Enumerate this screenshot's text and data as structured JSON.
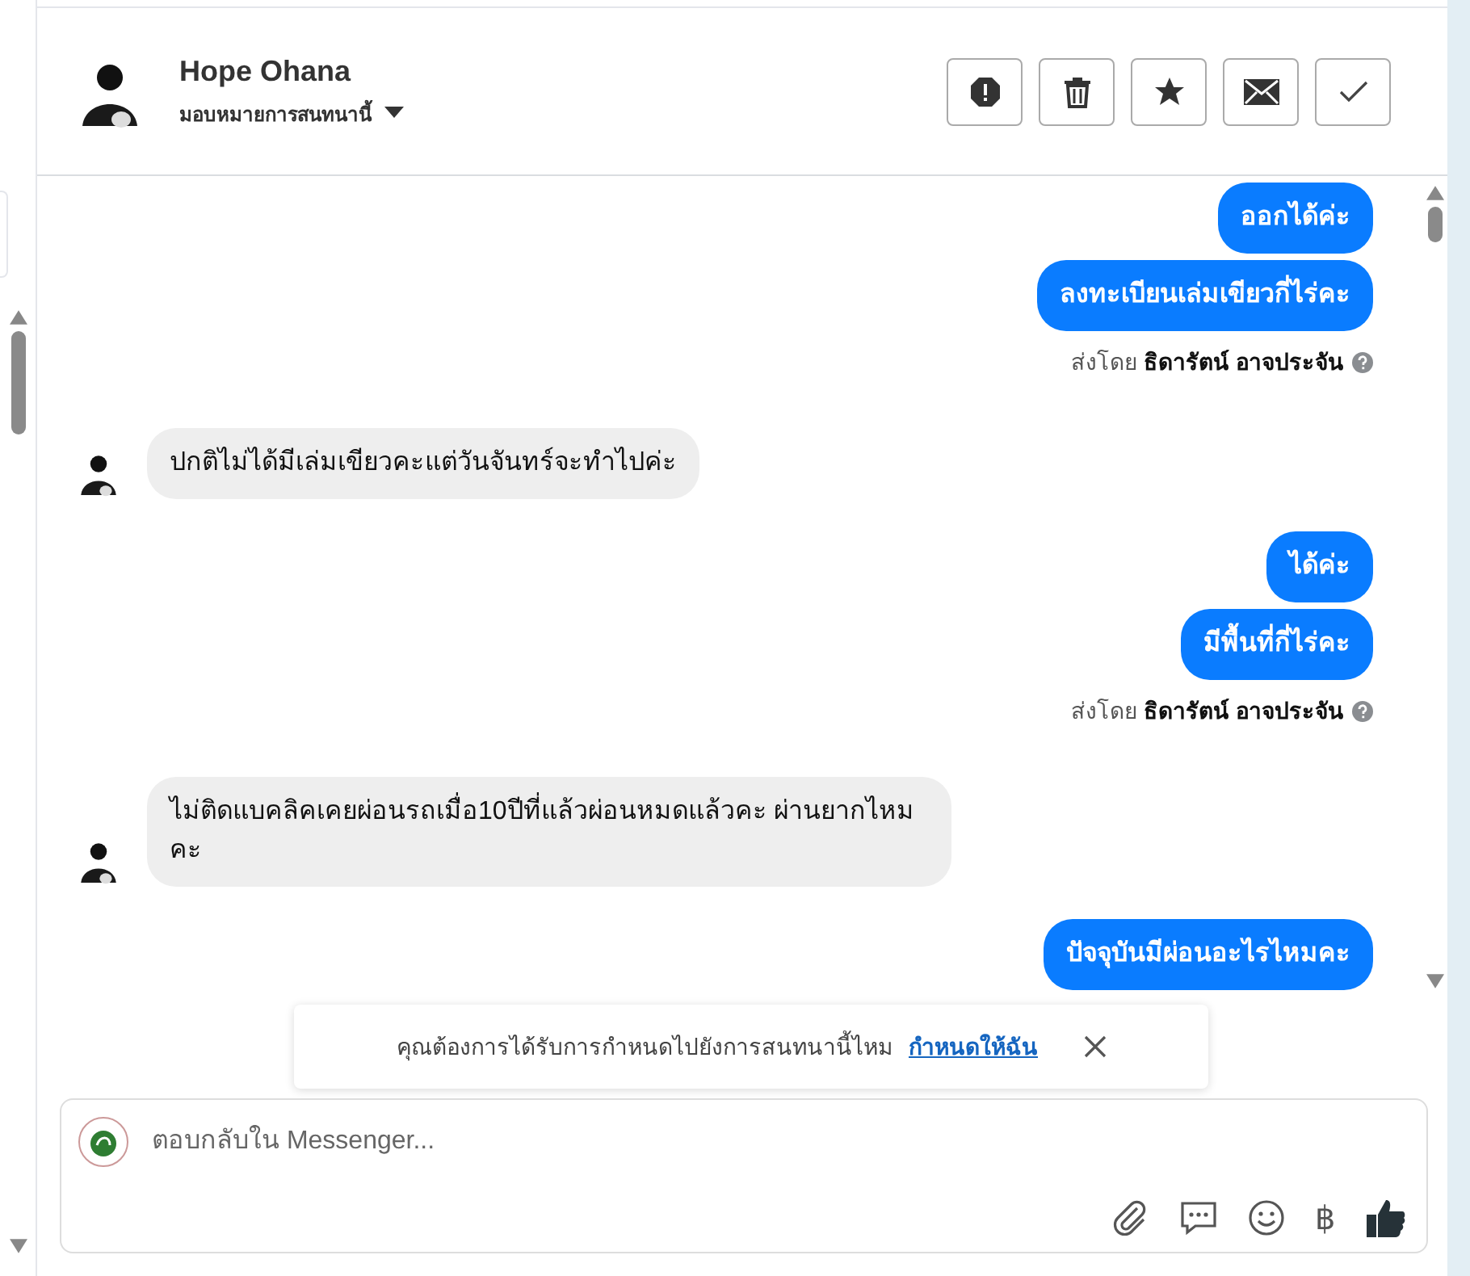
{
  "header": {
    "name": "Hope Ohana",
    "assign": "มอบหมายการสนทนานี้",
    "actions": [
      {
        "kind": "alert"
      },
      {
        "kind": "trash"
      },
      {
        "kind": "star"
      },
      {
        "kind": "mail"
      },
      {
        "kind": "check"
      }
    ]
  },
  "messages": [
    {
      "kind": "out",
      "text": "ออกได้ค่ะ"
    },
    {
      "kind": "out",
      "text": "ลงทะเบียนเล่มเขียวกี่ไร่คะ"
    },
    {
      "kind": "sent_by",
      "text": "ส่งโดย **ธิดารัตน์ อาจประจัน**"
    },
    {
      "kind": "in",
      "text": "ปกติไม่ได้มีเล่มเขียวคะแต่วันจันทร์จะทำไปค่ะ"
    },
    {
      "kind": "out",
      "text": "ได้ค่ะ"
    },
    {
      "kind": "out",
      "text": "มีพื้นที่กี่ไร่คะ"
    },
    {
      "kind": "sent_by",
      "text": "ส่งโดย **ธิดารัตน์ อาจประจัน**"
    },
    {
      "kind": "in",
      "text": "ไม่ติดแบคลิคเคยผ่อนรถเมื่อ10ปีที่แล้วผ่อนหมดแล้วคะ ผ่านยากไหมคะ"
    },
    {
      "kind": "out",
      "text": "ปัจจุบันมีผ่อนอะไรไหมคะ"
    }
  ],
  "toast": {
    "text": "คุณต้องการได้รับการกำหนดไปยังการสนทนานี้ไหม",
    "link": "กำหนดให้ฉัน"
  },
  "composer": {
    "placeholder": "ตอบกลับใน Messenger...",
    "tools": [
      {
        "kind": "clip"
      },
      {
        "kind": "chat"
      },
      {
        "kind": "smile"
      },
      {
        "kind": "baht",
        "text": "฿"
      },
      {
        "kind": "like"
      }
    ]
  }
}
